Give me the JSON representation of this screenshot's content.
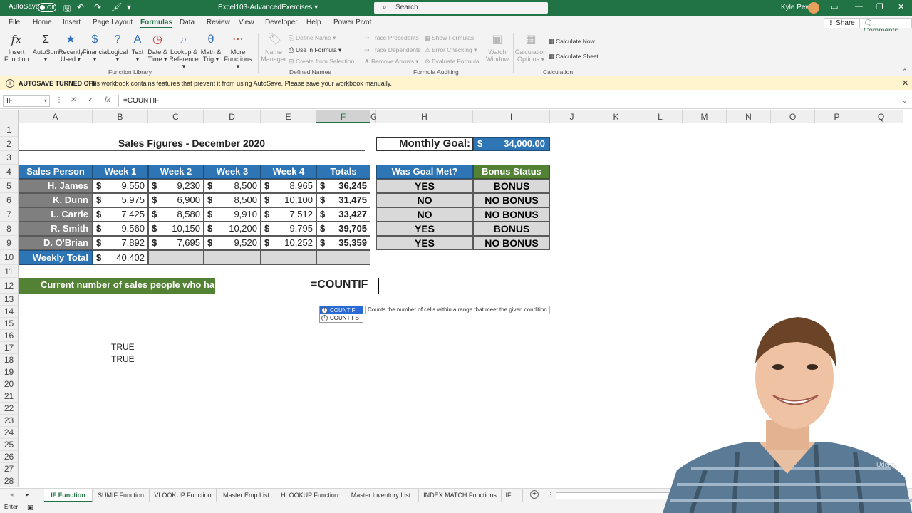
{
  "titlebar": {
    "autosave_label": "AutoSave",
    "autosave_state": "Off",
    "doc_title": "Excel103-AdvancedExercises ▾",
    "search_placeholder": "Search",
    "user_name": "Kyle Pew"
  },
  "tabs": [
    {
      "label": "File"
    },
    {
      "label": "Home"
    },
    {
      "label": "Insert"
    },
    {
      "label": "Page Layout"
    },
    {
      "label": "Formulas"
    },
    {
      "label": "Data"
    },
    {
      "label": "Review"
    },
    {
      "label": "View"
    },
    {
      "label": "Developer"
    },
    {
      "label": "Help"
    },
    {
      "label": "Power Pivot"
    }
  ],
  "active_tab": "Formulas",
  "share_label": "Share",
  "comments_label": "Comments",
  "ribbon": {
    "function_library": {
      "group_label": "Function Library",
      "buttons": [
        {
          "l1": "Insert",
          "l2": "Function",
          "icon": "fx"
        },
        {
          "l1": "AutoSum",
          "l2": "▾",
          "icon": "Σ"
        },
        {
          "l1": "Recently",
          "l2": "Used ▾",
          "icon": "★"
        },
        {
          "l1": "Financial",
          "l2": "▾",
          "icon": "$"
        },
        {
          "l1": "Logical",
          "l2": "▾",
          "icon": "?"
        },
        {
          "l1": "Text",
          "l2": "▾",
          "icon": "A"
        },
        {
          "l1": "Date &",
          "l2": "Time ▾",
          "icon": "◷"
        },
        {
          "l1": "Lookup &",
          "l2": "Reference ▾",
          "icon": "⌕"
        },
        {
          "l1": "Math &",
          "l2": "Trig ▾",
          "icon": "θ"
        },
        {
          "l1": "More",
          "l2": "Functions ▾",
          "icon": "⋯"
        }
      ]
    },
    "defined_names": {
      "group_label": "Defined Names",
      "name_manager_l1": "Name",
      "name_manager_l2": "Manager",
      "define_name": "Define Name ▾",
      "use_in_formula": "Use in Formula ▾",
      "create_from_selection": "Create from Selection"
    },
    "formula_auditing": {
      "group_label": "Formula Auditing",
      "trace_precedents": "Trace Precedents",
      "trace_dependents": "Trace Dependents",
      "remove_arrows": "Remove Arrows ▾",
      "show_formulas": "Show Formulas",
      "error_checking": "Error Checking ▾",
      "evaluate_formula": "Evaluate Formula",
      "watch_l1": "Watch",
      "watch_l2": "Window"
    },
    "calculation": {
      "group_label": "Calculation",
      "options_l1": "Calculation",
      "options_l2": "Options ▾",
      "calc_now": "Calculate Now",
      "calc_sheet": "Calculate Sheet"
    }
  },
  "infobar": {
    "heading": "AUTOSAVE TURNED OFF",
    "message": "This workbook contains features that prevent it from using AutoSave. Please save your workbook manually."
  },
  "formula_bar": {
    "name_box": "IF",
    "formula": "=COUNTIF"
  },
  "columns": [
    "A",
    "B",
    "C",
    "D",
    "E",
    "F",
    "G",
    "H",
    "I",
    "J",
    "K",
    "L",
    "M",
    "N",
    "O",
    "P",
    "Q"
  ],
  "selected_column": "F",
  "rows": [
    "1",
    "2",
    "3",
    "4",
    "5",
    "6",
    "7",
    "8",
    "9",
    "10",
    "11",
    "12",
    "13",
    "14",
    "15",
    "16",
    "17",
    "18",
    "19",
    "20",
    "21",
    "22",
    "23",
    "24",
    "25",
    "26",
    "27",
    "28"
  ],
  "sheet": {
    "title": "Sales Figures - December 2020",
    "monthly_goal_label": "Monthly Goal:",
    "monthly_goal_currency": "$",
    "monthly_goal_value": "34,000.00",
    "headers": [
      "Sales Person",
      "Week 1",
      "Week 2",
      "Week 3",
      "Week 4",
      "Totals"
    ],
    "status_headers": [
      "Was Goal Met?",
      "Bonus Status"
    ],
    "currency": "$",
    "people": [
      {
        "name": "H. James",
        "w1": "9,550",
        "w2": "9,230",
        "w3": "8,500",
        "w4": "8,965",
        "total": "36,245",
        "goal": "YES",
        "bonus": "BONUS"
      },
      {
        "name": "K. Dunn",
        "w1": "5,975",
        "w2": "6,900",
        "w3": "8,500",
        "w4": "10,100",
        "total": "31,475",
        "goal": "NO",
        "bonus": "NO BONUS"
      },
      {
        "name": "L. Carrie",
        "w1": "7,425",
        "w2": "8,580",
        "w3": "9,910",
        "w4": "7,512",
        "total": "33,427",
        "goal": "NO",
        "bonus": "NO BONUS"
      },
      {
        "name": "R. Smith",
        "w1": "9,560",
        "w2": "10,150",
        "w3": "10,200",
        "w4": "9,795",
        "total": "39,705",
        "goal": "YES",
        "bonus": "BONUS"
      },
      {
        "name": "D. O'Brian",
        "w1": "7,892",
        "w2": "7,695",
        "w3": "9,520",
        "w4": "10,252",
        "total": "35,359",
        "goal": "YES",
        "bonus": "NO BONUS"
      }
    ],
    "weekly_total_label": "Weekly Total",
    "weekly_total_value": "40,402",
    "banner_text": "Current number of sales people who ha",
    "editing_cell_text": "=COUNTIF",
    "true_values": [
      "TRUE",
      "TRUE"
    ]
  },
  "autocomplete": {
    "options": [
      "COUNTIF",
      "COUNTIFS"
    ],
    "description": "Counts the number of cells within a range that meet the given condition"
  },
  "sheet_tabs": [
    "IF Function",
    "SUMIF Function",
    "VLOOKUP Function",
    "Master Emp List",
    "HLOOKUP Function",
    "Master Inventory List",
    "INDEX MATCH Functions",
    "IF ..."
  ],
  "active_sheet": "IF Function",
  "status_text": "Enter",
  "watermark": "Udemy",
  "colors": {
    "excel_green": "#217346",
    "header_blue": "#2e75b6",
    "header_green": "#548235",
    "name_grey": "#7f7f7f"
  }
}
